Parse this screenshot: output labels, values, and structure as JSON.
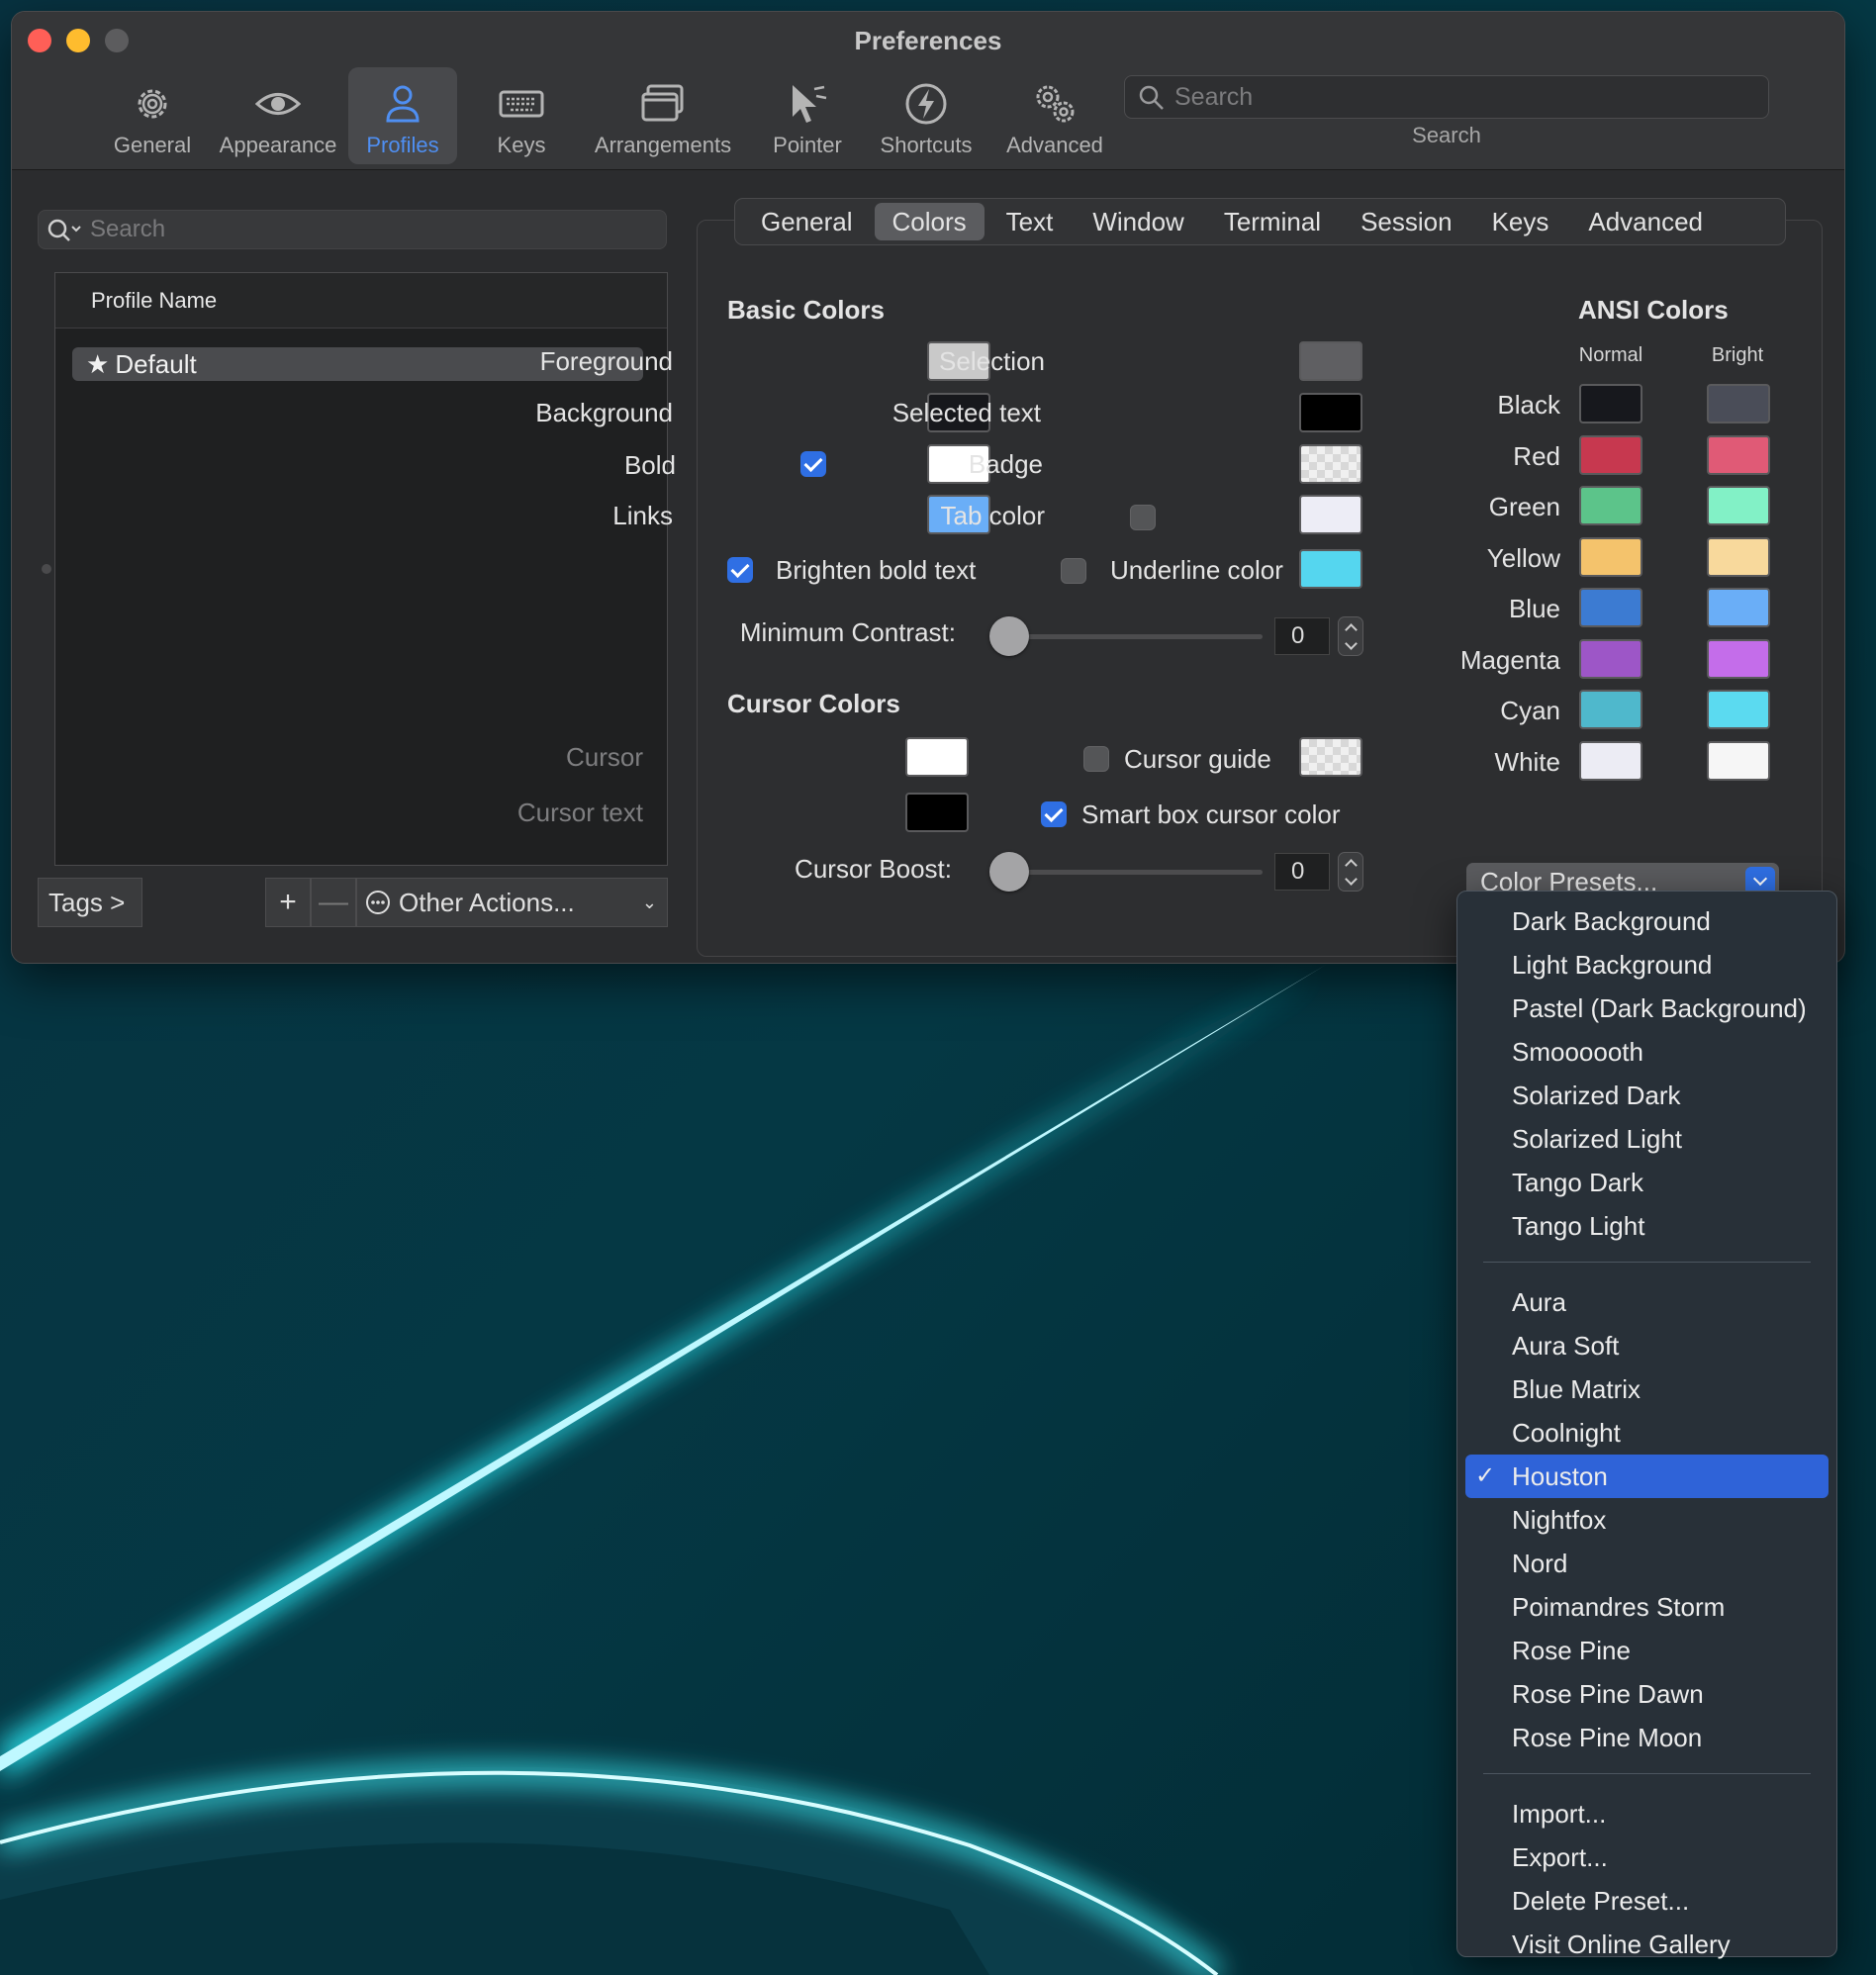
{
  "window": {
    "title": "Preferences"
  },
  "toolbar": {
    "items": [
      {
        "label": "General",
        "icon": "gear-icon"
      },
      {
        "label": "Appearance",
        "icon": "eye-icon"
      },
      {
        "label": "Profiles",
        "icon": "person-icon",
        "active": true
      },
      {
        "label": "Keys",
        "icon": "keyboard-icon"
      },
      {
        "label": "Arrangements",
        "icon": "windows-icon"
      },
      {
        "label": "Pointer",
        "icon": "pointer-icon"
      },
      {
        "label": "Shortcuts",
        "icon": "bolt-icon"
      },
      {
        "label": "Advanced",
        "icon": "gears-icon"
      }
    ],
    "search_placeholder": "Search",
    "search_caption": "Search"
  },
  "profiles": {
    "search_placeholder": "Search",
    "header": "Profile Name",
    "rows": [
      {
        "name": "Default",
        "icon": "star-icon"
      }
    ],
    "tags_label": "Tags >",
    "add_label": "+",
    "remove_label": "—",
    "other_actions_label": "Other Actions..."
  },
  "tabs": [
    "General",
    "Colors",
    "Text",
    "Window",
    "Terminal",
    "Session",
    "Keys",
    "Advanced"
  ],
  "active_tab": "Colors",
  "basic": {
    "title": "Basic Colors",
    "foreground": "Foreground",
    "background": "Background",
    "bold": "Bold",
    "links": "Links",
    "brighten": "Brighten bold text",
    "selection": "Selection",
    "selected_text": "Selected text",
    "badge": "Badge",
    "tab_color": "Tab color",
    "underline": "Underline color",
    "min_contrast": "Minimum Contrast:",
    "min_contrast_value": "0",
    "colors": {
      "foreground": "#c9c9c9",
      "background": "#17181c",
      "bold": "#ffffff",
      "links": "#6aaef7",
      "selection": "#5f5f62",
      "selected_text": "#000000",
      "tab_color": "#ededf6",
      "underline": "#55d6ef"
    },
    "checked": {
      "bold": true,
      "brighten": true,
      "tab_color": false,
      "underline": false
    }
  },
  "cursor": {
    "title": "Cursor Colors",
    "cursor": "Cursor",
    "cursor_text": "Cursor text",
    "guide": "Cursor guide",
    "smart": "Smart box cursor color",
    "boost": "Cursor Boost:",
    "boost_value": "0",
    "colors": {
      "cursor": "#ffffff",
      "cursor_text": "#000000"
    },
    "checked": {
      "guide": false,
      "smart": true
    }
  },
  "ansi": {
    "title": "ANSI Colors",
    "normal_label": "Normal",
    "bright_label": "Bright",
    "rows": [
      {
        "name": "Black",
        "normal": "#17181d",
        "bright": "#4a4d58"
      },
      {
        "name": "Red",
        "normal": "#c7384f",
        "bright": "#e05a76"
      },
      {
        "name": "Green",
        "normal": "#5cc48a",
        "bright": "#82f1c6"
      },
      {
        "name": "Yellow",
        "normal": "#f4c36c",
        "bright": "#f8d99c"
      },
      {
        "name": "Blue",
        "normal": "#3c7bd2",
        "bright": "#6aaef7"
      },
      {
        "name": "Magenta",
        "normal": "#9d56c7",
        "bright": "#c46dea"
      },
      {
        "name": "Cyan",
        "normal": "#4fb8cc",
        "bright": "#5bdaf0"
      },
      {
        "name": "White",
        "normal": "#ececf4",
        "bright": "#f6f6f6"
      }
    ]
  },
  "presets": {
    "button_label": "Color Presets...",
    "group1": [
      "Dark Background",
      "Light Background",
      "Pastel (Dark Background)",
      "Smoooooth",
      "Solarized Dark",
      "Solarized Light",
      "Tango Dark",
      "Tango Light"
    ],
    "group2": [
      "Aura",
      "Aura Soft",
      "Blue Matrix",
      "Coolnight",
      "Houston",
      "Nightfox",
      "Nord",
      "Poimandres Storm",
      "Rose Pine",
      "Rose Pine Dawn",
      "Rose Pine Moon"
    ],
    "group3": [
      "Import...",
      "Export...",
      "Delete Preset...",
      "Visit Online Gallery"
    ],
    "selected": "Houston",
    "check_glyph": "✓"
  }
}
